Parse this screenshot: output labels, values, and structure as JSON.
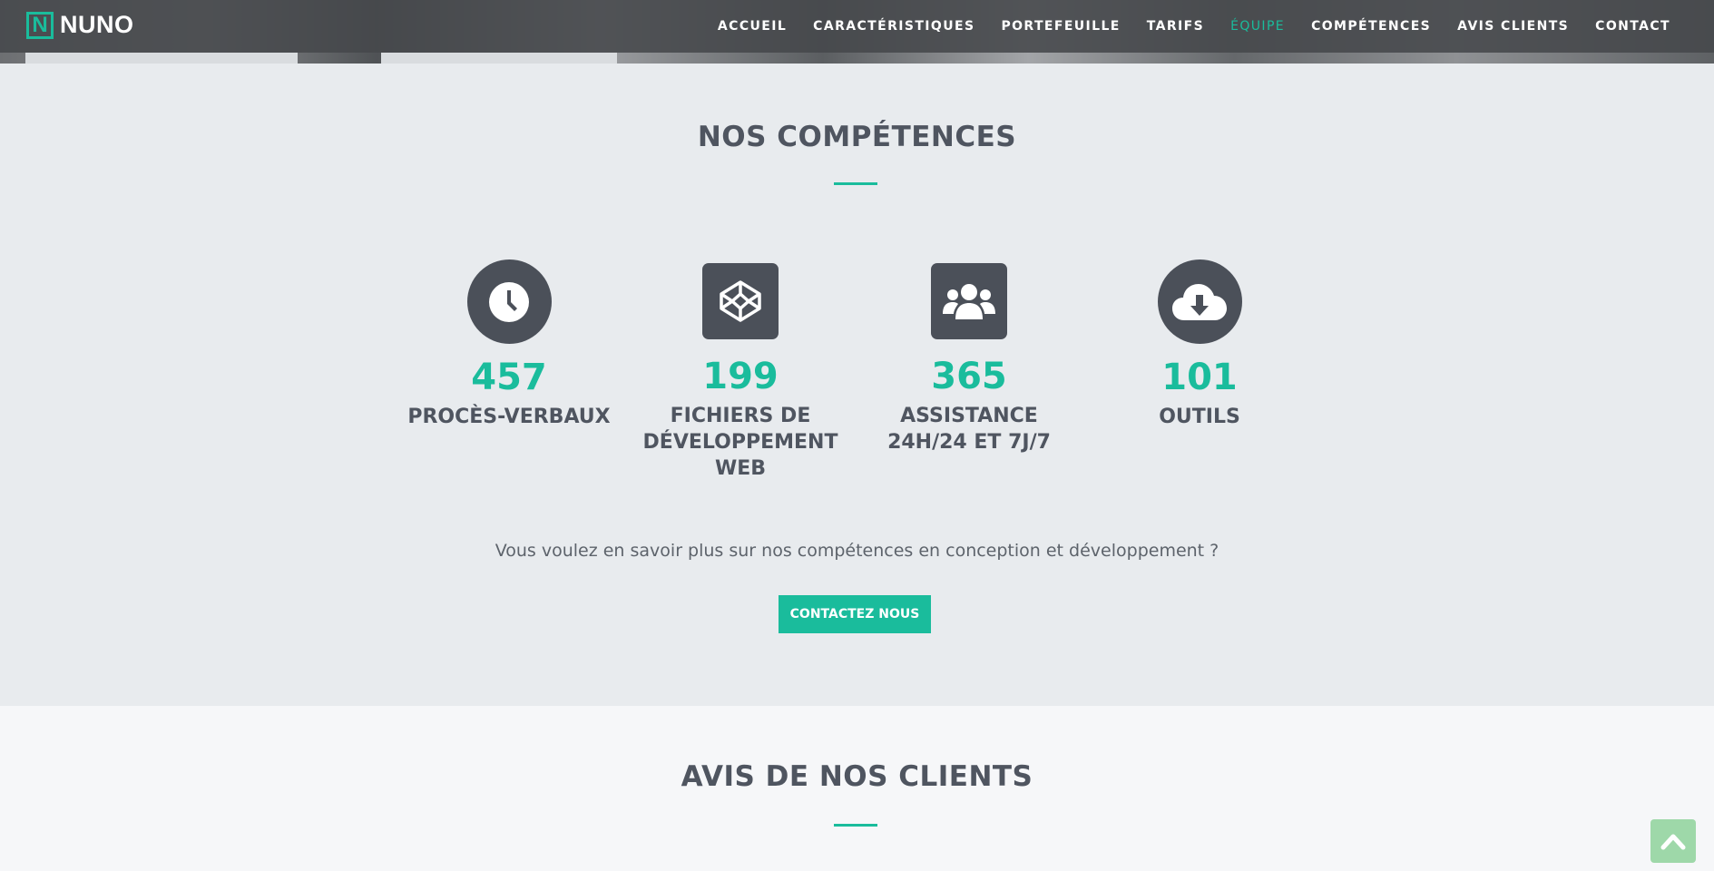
{
  "brand": {
    "logo_letter": "N",
    "name": "NUNO"
  },
  "nav": {
    "items": [
      {
        "label": "ACCUEIL",
        "active": false
      },
      {
        "label": "CARACTÉRISTIQUES",
        "active": false
      },
      {
        "label": "PORTEFEUILLE",
        "active": false
      },
      {
        "label": "TARIFS",
        "active": false
      },
      {
        "label": "ÉQUIPE",
        "active": true
      },
      {
        "label": "COMPÉTENCES",
        "active": false
      },
      {
        "label": "AVIS CLIENTS",
        "active": false
      },
      {
        "label": "CONTACT",
        "active": false
      }
    ]
  },
  "skills": {
    "title": "NOS COMPÉTENCES",
    "stats": [
      {
        "icon": "clock-icon",
        "number": "457",
        "label": "PROCÈS-VERBAUX"
      },
      {
        "icon": "codepen-icon",
        "number": "199",
        "label": "FICHIERS DE DÉVELOPPEMENT WEB"
      },
      {
        "icon": "users-icon",
        "number": "365",
        "label": "ASSISTANCE 24H/24 ET 7J/7"
      },
      {
        "icon": "cloud-download-icon",
        "number": "101",
        "label": "OUTILS"
      }
    ],
    "cta_text": "Vous voulez en savoir plus sur nos compétences en conception et développement ?",
    "cta_button": "CONTACTEZ NOUS"
  },
  "reviews": {
    "title": "AVIS DE NOS CLIENTS"
  },
  "colors": {
    "accent": "#1abc9c",
    "dark": "#4b5059",
    "section_bg": "#e8ebee"
  }
}
